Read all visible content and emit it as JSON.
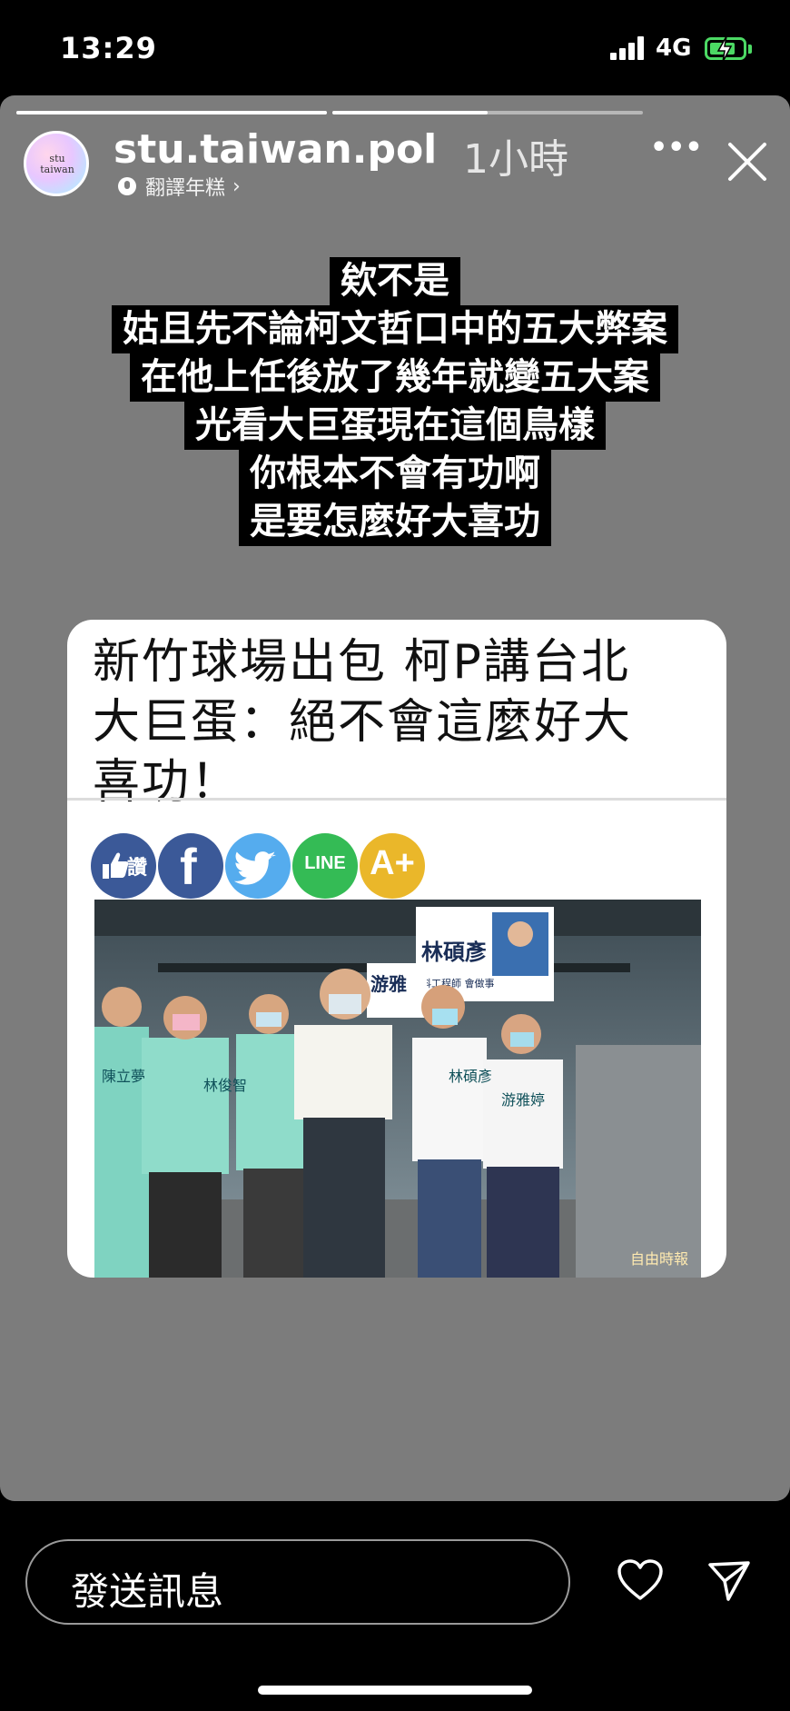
{
  "status": {
    "time": "13:29",
    "network": "4G",
    "battery_level": 0.8
  },
  "story": {
    "progress": [
      1.0,
      0.5
    ],
    "username": "stu.taiwan.pol",
    "time_ago": "1小時",
    "translate_label": "翻譯年糕",
    "more_label": "•••",
    "caption_lines": [
      "欸不是",
      "姑且先不論柯文哲口中的五大弊案",
      "在他上任後放了幾年就變五大案",
      "光看大巨蛋現在這個鳥樣",
      "你根本不會有功啊",
      "是要怎麼好大喜功"
    ],
    "article": {
      "headline_lines": [
        "新竹球場出包 柯P講台北",
        "大巨蛋：絕不會這麼好大",
        "喜功！"
      ],
      "share_buttons": [
        {
          "name": "like",
          "label": "讚",
          "color": "#3b5998"
        },
        {
          "name": "facebook",
          "label": "f",
          "color": "#3b5998"
        },
        {
          "name": "twitter",
          "label": "twitter",
          "color": "#55acee"
        },
        {
          "name": "line",
          "label": "LINE",
          "color": "#34bb55"
        },
        {
          "name": "font-size",
          "label": "A+",
          "color": "#eab72a"
        }
      ],
      "photo": {
        "signs": [
          "林碩彥",
          "游雅婷"
        ],
        "sashes": [
          "陳立夢",
          "林俊智",
          "林碩彥",
          "游雅婷"
        ],
        "sign_sub": "科工程師 會做事",
        "watermark": "自由時報"
      }
    }
  },
  "reply": {
    "placeholder": "發送訊息"
  }
}
